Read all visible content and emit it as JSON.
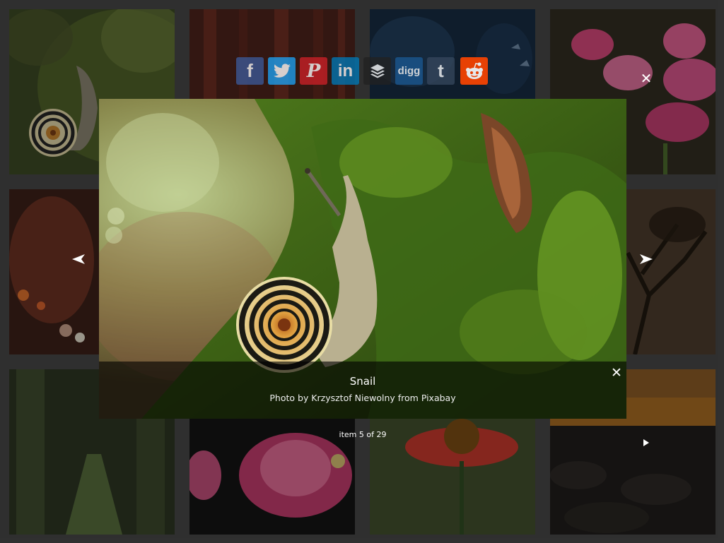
{
  "lightbox": {
    "title": "Snail",
    "description": "Photo by Krzysztof Niewolny from Pixabay",
    "counter": "item 5 of 29",
    "close_label": "✕",
    "caption_close_label": "✕"
  },
  "share": {
    "buttons": [
      {
        "name": "facebook",
        "label": "f",
        "color": "#3b5998",
        "icon": "facebook-icon"
      },
      {
        "name": "twitter",
        "label": "",
        "color": "#1da1f2",
        "icon": "twitter-icon"
      },
      {
        "name": "pinterest",
        "label": "P",
        "color": "#cb2027",
        "icon": "pinterest-icon"
      },
      {
        "name": "linkedin",
        "label": "in",
        "color": "#0077b5",
        "icon": "linkedin-icon"
      },
      {
        "name": "buffer",
        "label": "",
        "color": "#222222",
        "icon": "buffer-icon"
      },
      {
        "name": "digg",
        "label": "digg",
        "color": "#1b5891",
        "icon": "digg-icon"
      },
      {
        "name": "tumblr",
        "label": "t",
        "color": "#35465c",
        "icon": "tumblr-icon"
      },
      {
        "name": "reddit",
        "label": "",
        "color": "#ff4500",
        "icon": "reddit-icon"
      }
    ]
  },
  "gallery": {
    "thumbnails": [
      {
        "name": "snail",
        "icon": "snail-photo"
      },
      {
        "name": "red-forest",
        "icon": "forest-photo"
      },
      {
        "name": "blue-butterflies",
        "icon": "butterfly-photo"
      },
      {
        "name": "pink-flowers",
        "icon": "flower-photo"
      },
      {
        "name": "cafe-lights",
        "icon": "lights-photo"
      },
      {
        "name": "hidden-1",
        "icon": "photo"
      },
      {
        "name": "hidden-2",
        "icon": "photo"
      },
      {
        "name": "tree-silhouette",
        "icon": "tree-photo"
      },
      {
        "name": "green-tunnel",
        "icon": "forest-photo"
      },
      {
        "name": "pink-tulip",
        "icon": "flower-photo"
      },
      {
        "name": "red-daisy",
        "icon": "flower-photo"
      },
      {
        "name": "sunset-sea",
        "icon": "sea-photo"
      }
    ]
  },
  "colors": {
    "page_background": "#444444",
    "caption_background": "rgba(0,0,0,0.62)"
  }
}
